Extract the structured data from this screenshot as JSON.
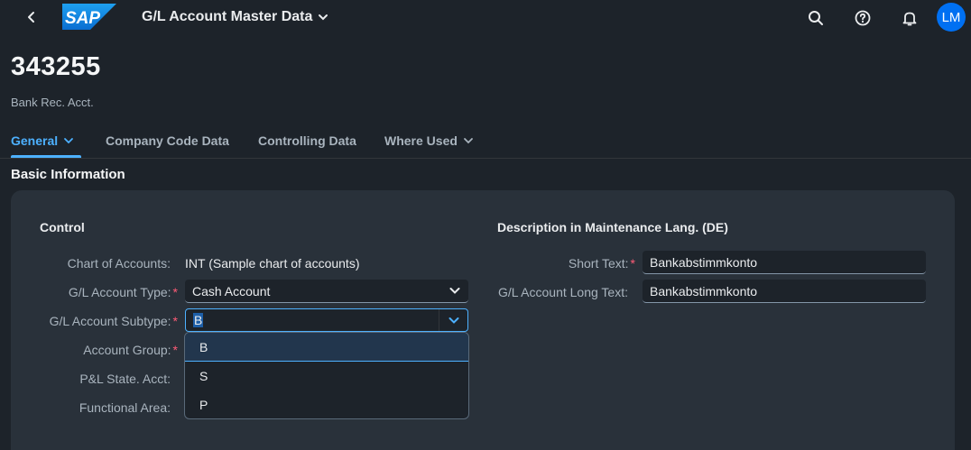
{
  "shell": {
    "app_title": "G/L Account Master Data",
    "logo_text": "SAP",
    "avatar_initials": "LM",
    "icons": [
      "back-icon",
      "search-icon",
      "help-icon",
      "notification-bell-icon"
    ]
  },
  "header": {
    "title": "343255",
    "subtitle": "Bank Rec. Acct."
  },
  "tabs": [
    {
      "label": "General",
      "active": true
    },
    {
      "label": "Company Code Data",
      "active": false
    },
    {
      "label": "Controlling Data",
      "active": false
    },
    {
      "label": "Where Used",
      "active": false
    }
  ],
  "section": {
    "title": "Basic Information"
  },
  "control": {
    "title": "Control",
    "chart_of_accounts_label": "Chart of Accounts:",
    "chart_of_accounts_value": "INT (Sample chart of accounts)",
    "gl_type_label": "G/L Account Type:",
    "gl_type_value": "Cash Account",
    "subtype_label": "G/L Account Subtype:",
    "subtype_value": "B",
    "account_group_label": "Account Group:",
    "pl_label": "P&L State. Acct:",
    "functional_area_label": "Functional Area:",
    "required_marker": "*"
  },
  "dropdown": {
    "options": [
      "B",
      "S",
      "P"
    ],
    "selected": "B"
  },
  "description": {
    "title": "Description in Maintenance Lang. (DE)",
    "short_text_label": "Short Text:",
    "short_text_value": "Bankabstimmkonto",
    "long_text_label": "G/L Account Long Text:",
    "long_text_value": "Bankabstimmkonto"
  },
  "colors": {
    "background": "#1d232a",
    "card": "#29313a",
    "accent": "#4db1ff",
    "required": "#ff5c77",
    "avatar": "#0070f2"
  }
}
